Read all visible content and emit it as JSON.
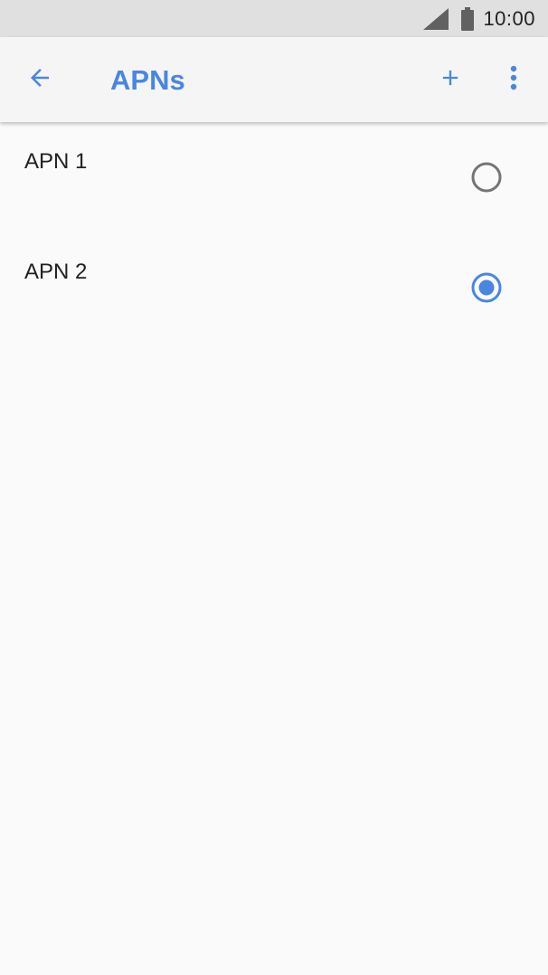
{
  "status_bar": {
    "time": "10:00",
    "icons": [
      "signal-icon",
      "battery-icon"
    ]
  },
  "app_bar": {
    "title": "APNs",
    "back_icon": "arrow-back-icon",
    "add_icon": "add-icon",
    "overflow_icon": "more-vert-icon"
  },
  "apn_list": [
    {
      "name": "APN 1",
      "selected": false
    },
    {
      "name": "APN 2",
      "selected": true
    }
  ],
  "colors": {
    "accent": "#4a86e0",
    "status_bar_bg": "#e0e0e0",
    "app_bar_bg": "#f5f5f5",
    "background": "#fafafa",
    "radio_unselected": "#757575",
    "text_primary": "#212121"
  }
}
